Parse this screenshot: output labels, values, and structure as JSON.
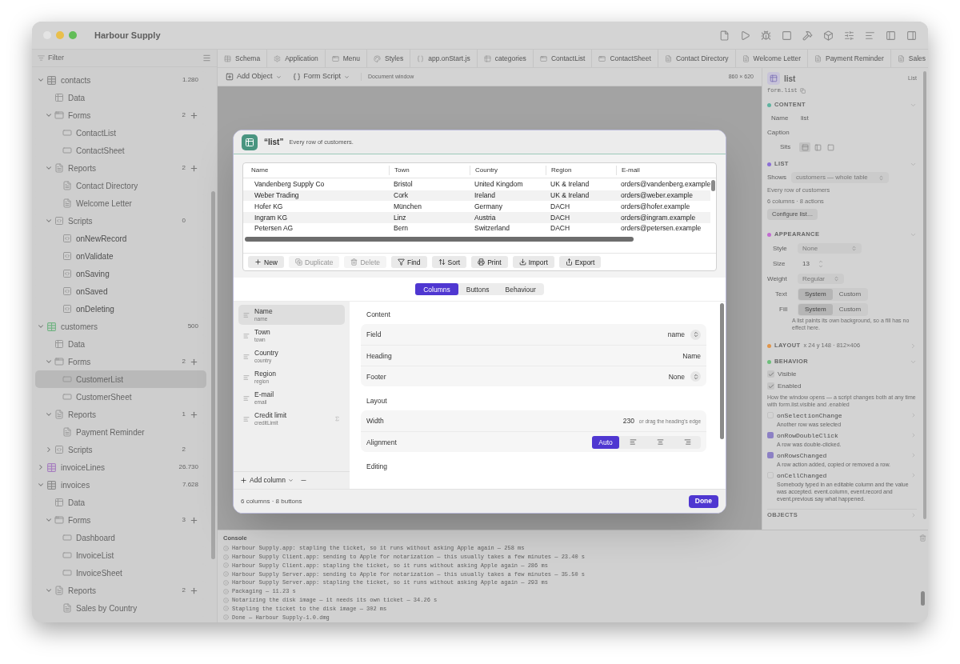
{
  "window": {
    "title": "Harbour Supply"
  },
  "sidebar": {
    "filter_placeholder": "Filter",
    "tree": [
      {
        "label": "contacts",
        "kind": "table",
        "color": "#8c8c8c",
        "count": "1.280",
        "expanded": true,
        "selected": false,
        "children": [
          {
            "label": "Data",
            "kind": "data",
            "selected": false
          },
          {
            "label": "Forms",
            "kind": "forms",
            "count": "2",
            "add_button": true,
            "expanded": true,
            "selected": false,
            "children": [
              {
                "label": "ContactList",
                "kind": "form",
                "selected": false
              },
              {
                "label": "ContactSheet",
                "kind": "form",
                "selected": false
              }
            ]
          },
          {
            "label": "Reports",
            "kind": "reports",
            "count": "2",
            "add_button": true,
            "expanded": true,
            "selected": false,
            "children": [
              {
                "label": "Contact Directory",
                "kind": "report",
                "selected": false
              },
              {
                "label": "Welcome Letter",
                "kind": "report",
                "selected": false
              }
            ]
          },
          {
            "label": "Scripts",
            "kind": "scripts",
            "count": "0",
            "add_button": false,
            "expanded": true,
            "selected": false,
            "children": [
              {
                "label": "onNewRecord",
                "kind": "script",
                "selected": false
              },
              {
                "label": "onValidate",
                "kind": "script",
                "selected": false
              },
              {
                "label": "onSaving",
                "kind": "script",
                "selected": false
              },
              {
                "label": "onSaved",
                "kind": "script",
                "selected": false
              },
              {
                "label": "onDeleting",
                "kind": "script",
                "selected": false
              }
            ]
          }
        ]
      },
      {
        "label": "customers",
        "kind": "table",
        "color": "#72b483",
        "count": "500",
        "expanded": true,
        "selected": false,
        "children": [
          {
            "label": "Data",
            "kind": "data",
            "selected": false
          },
          {
            "label": "Forms",
            "kind": "forms",
            "count": "2",
            "add_button": true,
            "expanded": true,
            "selected": false,
            "children": [
              {
                "label": "CustomerList",
                "kind": "form",
                "selected": true
              },
              {
                "label": "CustomerSheet",
                "kind": "form",
                "selected": false
              }
            ]
          },
          {
            "label": "Reports",
            "kind": "reports",
            "count": "1",
            "add_button": true,
            "expanded": true,
            "selected": false,
            "children": [
              {
                "label": "Payment Reminder",
                "kind": "report",
                "selected": false
              }
            ]
          },
          {
            "label": "Scripts",
            "kind": "scripts",
            "count": "2",
            "add_button": false,
            "expanded": false,
            "selected": false
          }
        ]
      },
      {
        "label": "invoiceLines",
        "kind": "table",
        "color": "#a77fc0",
        "count": "26.730",
        "expanded": false,
        "selected": false
      },
      {
        "label": "invoices",
        "kind": "table",
        "color": "#8c8c8c",
        "count": "7.628",
        "expanded": true,
        "selected": false,
        "children": [
          {
            "label": "Data",
            "kind": "data",
            "selected": false
          },
          {
            "label": "Forms",
            "kind": "forms",
            "count": "3",
            "add_button": true,
            "expanded": true,
            "selected": false,
            "children": [
              {
                "label": "Dashboard",
                "kind": "form",
                "selected": false
              },
              {
                "label": "InvoiceList",
                "kind": "form",
                "selected": false
              },
              {
                "label": "InvoiceSheet",
                "kind": "form",
                "selected": false
              }
            ]
          },
          {
            "label": "Reports",
            "kind": "reports",
            "count": "2",
            "add_button": true,
            "expanded": true,
            "selected": false,
            "children": [
              {
                "label": "Sales by Country",
                "kind": "report",
                "selected": false
              }
            ]
          }
        ]
      }
    ]
  },
  "tabs": [
    {
      "label": "Schema",
      "kind": "schema",
      "selected": false
    },
    {
      "label": "Application",
      "kind": "app",
      "selected": false
    },
    {
      "label": "Menu",
      "kind": "form",
      "selected": false
    },
    {
      "label": "Styles",
      "kind": "styles",
      "selected": false
    },
    {
      "label": "app.onStart.js",
      "kind": "script",
      "selected": false
    },
    {
      "label": "categories",
      "kind": "table",
      "selected": false
    },
    {
      "label": "ContactList",
      "kind": "form",
      "selected": false
    },
    {
      "label": "ContactSheet",
      "kind": "form",
      "selected": false
    },
    {
      "label": "Contact Directory",
      "kind": "report",
      "selected": false
    },
    {
      "label": "Welcome Letter",
      "kind": "report",
      "selected": false
    },
    {
      "label": "Payment Reminder",
      "kind": "report",
      "selected": false
    },
    {
      "label": "Sales",
      "kind": "report",
      "selected": false
    }
  ],
  "toolbar": {
    "add_object": "Add Object",
    "form_script": "Form Script",
    "window_kind": "Document window",
    "window_size": "860 × 620"
  },
  "dialog": {
    "title": "“list”",
    "subtitle": "Every row of customers.",
    "table": {
      "columns": [
        "Name",
        "Town",
        "Country",
        "Region",
        "E-mail"
      ],
      "rows": [
        [
          "Vandenberg Supply Co",
          "Bristol",
          "United Kingdom",
          "UK & Ireland",
          "orders@vandenberg.example"
        ],
        [
          "Weber Trading",
          "Cork",
          "Ireland",
          "UK & Ireland",
          "orders@weber.example"
        ],
        [
          "Hofer KG",
          "München",
          "Germany",
          "DACH",
          "orders@hofer.example"
        ],
        [
          "Ingram KG",
          "Linz",
          "Austria",
          "DACH",
          "orders@ingram.example"
        ],
        [
          "Petersen AG",
          "Bern",
          "Switzerland",
          "DACH",
          "orders@petersen.example"
        ]
      ]
    },
    "actions": [
      {
        "label": "New",
        "kind": "new",
        "disabled": false
      },
      {
        "label": "Duplicate",
        "kind": "duplicate",
        "disabled": true
      },
      {
        "label": "Delete",
        "kind": "delete",
        "disabled": true
      },
      {
        "label": "Find",
        "kind": "find",
        "disabled": false
      },
      {
        "label": "Sort",
        "kind": "sort",
        "disabled": false
      },
      {
        "label": "Print",
        "kind": "print",
        "disabled": false
      },
      {
        "label": "Import",
        "kind": "import",
        "disabled": false
      },
      {
        "label": "Export",
        "kind": "export",
        "disabled": false
      }
    ],
    "tabs": [
      {
        "label": "Columns",
        "selected": true
      },
      {
        "label": "Buttons",
        "selected": false
      },
      {
        "label": "Behaviour",
        "selected": false
      }
    ],
    "columns_list": [
      {
        "label": "Name",
        "field": "name",
        "summed": false,
        "selected": true
      },
      {
        "label": "Town",
        "field": "town",
        "summed": false,
        "selected": false
      },
      {
        "label": "Country",
        "field": "country",
        "summed": false,
        "selected": false
      },
      {
        "label": "Region",
        "field": "region",
        "summed": false,
        "selected": false
      },
      {
        "label": "E-mail",
        "field": "email",
        "summed": false,
        "selected": false
      },
      {
        "label": "Credit limit",
        "field": "creditLimit",
        "summed": true,
        "selected": false
      }
    ],
    "add_column": "Add column",
    "sections": [
      {
        "title": "Content",
        "rows": [
          {
            "label": "Field",
            "value": "name",
            "kind": "select"
          },
          {
            "label": "Heading",
            "value": "Name",
            "kind": "text"
          },
          {
            "label": "Footer",
            "value": "None",
            "kind": "select"
          }
        ]
      },
      {
        "title": "Layout",
        "rows": [
          {
            "label": "Width",
            "value": "230",
            "hint": "or drag the heading's edge",
            "kind": "number"
          },
          {
            "label": "Alignment",
            "kind": "alignment",
            "options": [
              {
                "kind": "auto",
                "label": "Auto",
                "selected": true
              },
              {
                "kind": "left",
                "selected": false
              },
              {
                "kind": "center",
                "selected": false
              },
              {
                "kind": "right",
                "selected": false
              }
            ]
          }
        ]
      },
      {
        "title": "Editing"
      }
    ],
    "footer": "6 columns · 8 buttons",
    "done": "Done"
  },
  "inspector": {
    "title": "list",
    "type": "List",
    "path": "form.list",
    "content": {
      "title": "CONTENT",
      "color": "#5fb3a0",
      "expanded": true,
      "name_label": "Name",
      "name_value": "list",
      "caption_label": "Caption",
      "sits_label": "Sits",
      "sits_options": [
        {
          "kind": "top",
          "selected": true
        },
        {
          "kind": "left",
          "selected": false
        },
        {
          "kind": "none",
          "selected": false
        }
      ]
    },
    "list": {
      "title": "LIST",
      "color": "#8b6fd6",
      "expanded": true,
      "shows_label": "Shows",
      "shows_value": "customers — whole table",
      "description": "Every row of customers",
      "summary": "6 columns · 8 actions",
      "button": "Configure list…"
    },
    "appearance": {
      "title": "APPEARANCE",
      "color": "#c26bd1",
      "expanded": true,
      "style_label": "Style",
      "style_value": "None",
      "size_label": "Size",
      "size_value": "13",
      "weight_label": "Weight",
      "weight_value": "Regular",
      "text_label": "Text",
      "text_options": [
        {
          "label": "System",
          "selected": true
        },
        {
          "label": "Custom",
          "selected": false
        }
      ],
      "fill_label": "Fill",
      "fill_options": [
        {
          "label": "System",
          "selected": true
        },
        {
          "label": "Custom",
          "selected": false
        }
      ],
      "note": "A list paints its own background, so a fill has no effect here."
    },
    "layout": {
      "title": "LAYOUT",
      "color": "#e0954a",
      "expanded": false,
      "summary": "x 24 y 148 · 812×406"
    },
    "behavior": {
      "title": "BEHAVIOR",
      "color": "#6cbf7a",
      "expanded": true,
      "checks": [
        {
          "label": "Visible",
          "checked": true
        },
        {
          "label": "Enabled",
          "checked": true
        }
      ],
      "note": "How the window opens — a script changes both at any time with form.list.visible and .enabled",
      "events": [
        {
          "name": "onSelectionChange",
          "description": "Another row was selected",
          "active": false
        },
        {
          "name": "onRowDoubleClick",
          "description": "A row was double-clicked.",
          "active": true
        },
        {
          "name": "onRowsChanged",
          "description": "A row action added, copied or removed a row.",
          "active": true
        },
        {
          "name": "onCellChanged",
          "description": "Somebody typed in an editable column and the value was accepted. event.column, event.record and event.previous say what happened.",
          "active": false
        }
      ]
    },
    "objects": {
      "title": "OBJECTS",
      "expanded": false
    }
  },
  "console": {
    "title": "Console",
    "lines": [
      "Harbour Supply.app: stapling the ticket, so it runs without asking Apple again — 258 ms",
      "Harbour Supply Client.app: sending to Apple for notarization — this usually takes a few minutes — 23.40 s",
      "Harbour Supply Client.app: stapling the ticket, so it runs without asking Apple again — 286 ms",
      "Harbour Supply Server.app: sending to Apple for notarization — this usually takes a few minutes — 35.50 s",
      "Harbour Supply Server.app: stapling the ticket, so it runs without asking Apple again — 293 ms",
      "Packaging — 11.23 s",
      "Notarizing the disk image — it needs its own ticket — 34.26 s",
      "Stapling the ticket to the disk image — 302 ms",
      "Done — Harbour Supply-1.0.dmg"
    ]
  }
}
